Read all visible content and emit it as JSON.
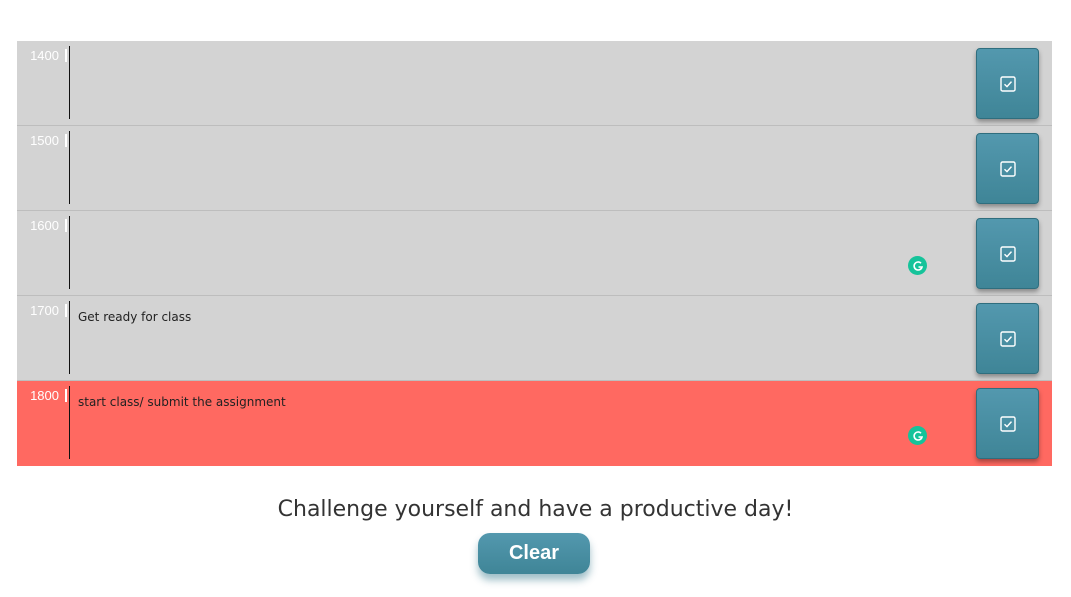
{
  "rows": [
    {
      "hour": "1400",
      "text": "",
      "state": "past",
      "grammarly": false
    },
    {
      "hour": "1500",
      "text": "",
      "state": "past",
      "grammarly": false
    },
    {
      "hour": "1600",
      "text": "",
      "state": "past",
      "grammarly": true
    },
    {
      "hour": "1700",
      "text": "Get ready for class",
      "state": "past",
      "grammarly": false
    },
    {
      "hour": "1800",
      "text": "start class/ submit the assignment",
      "state": "present",
      "grammarly": true
    }
  ],
  "save_icon": "checkbox-save-icon",
  "grammarly_icon": "grammarly-g-icon",
  "footer": {
    "message": "Challenge yourself and have a productive day!",
    "clear_label": "Clear"
  },
  "colors": {
    "past": "#d3d3d3",
    "present": "#ff6961",
    "button": "#4a8fa4",
    "grammarly": "#15c39a"
  }
}
